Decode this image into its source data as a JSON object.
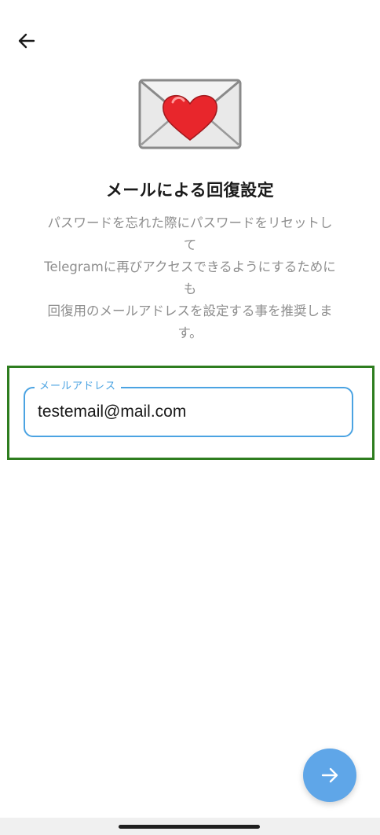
{
  "header": {
    "back_icon": "arrow-left-icon"
  },
  "illustration": {
    "icon": "envelope-heart-icon",
    "heart_color": "#e8262c",
    "envelope_color": "#e9e9e9"
  },
  "title": "メールによる回復設定",
  "description_lines": [
    "パスワードを忘れた際にパスワードをリセットし",
    "て",
    "Telegramに再びアクセスできるようにするために",
    "も",
    "回復用のメールアドレスを設定する事を推奨しま",
    "す。"
  ],
  "email_field": {
    "label": "メールアドレス",
    "value": "testemail@mail.com"
  },
  "next_button": {
    "icon": "arrow-right-icon",
    "color": "#5fa6e8"
  },
  "colors": {
    "accent": "#4ba3e2",
    "highlight": "#2e7d1f"
  }
}
